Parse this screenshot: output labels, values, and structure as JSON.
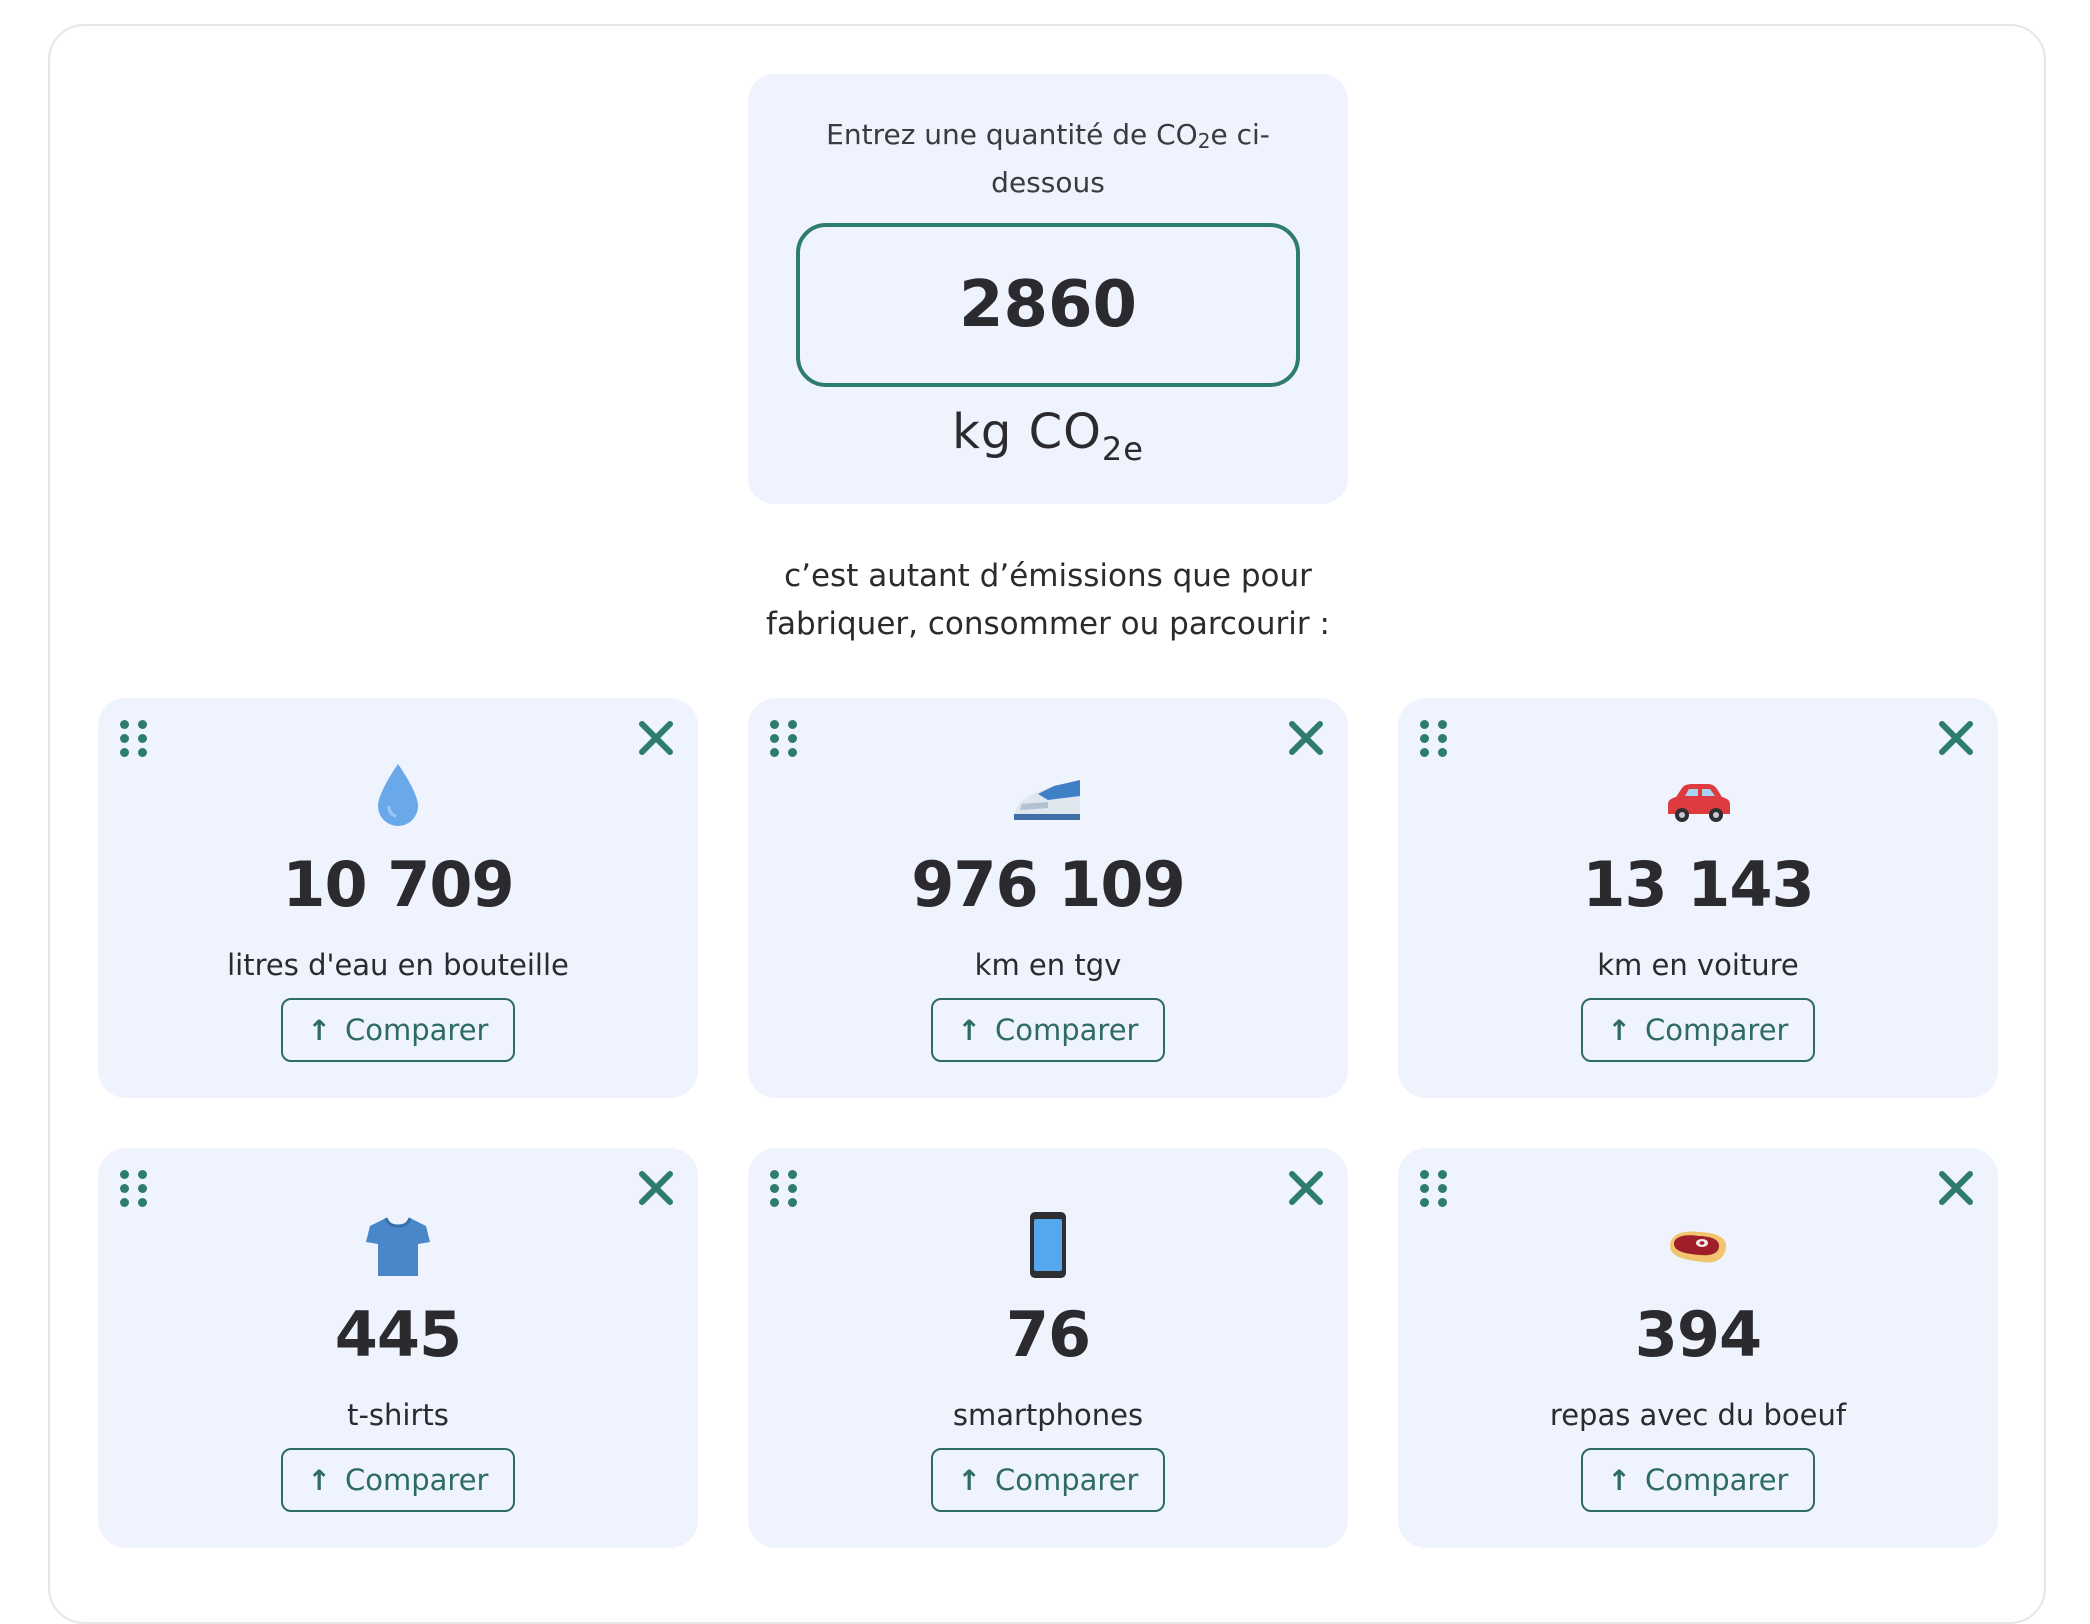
{
  "converter": {
    "prompt_main": "Entrez une quantité de CO",
    "prompt_sub": "2",
    "prompt_end": "e ci-dessous",
    "quantity": "2860",
    "unit_main": "kg CO",
    "unit_sub": "2e"
  },
  "tagline": {
    "line1": "c’est autant d’émissions que pour",
    "line2": "fabriquer, consommer ou parcourir :"
  },
  "compare_label": "Comparer",
  "items": [
    {
      "icon": "water-drop-icon",
      "value": "10 709",
      "label": "litres d'eau en bouteille"
    },
    {
      "icon": "high-speed-train-icon",
      "value": "976 109",
      "label": "km en tgv"
    },
    {
      "icon": "car-icon",
      "value": "13 143",
      "label": "km en voiture"
    },
    {
      "icon": "t-shirt-icon",
      "value": "445",
      "label": "t-shirts"
    },
    {
      "icon": "smartphone-icon",
      "value": "76",
      "label": "smartphones"
    },
    {
      "icon": "steak-icon",
      "value": "394",
      "label": "repas avec du boeuf"
    }
  ],
  "colors": {
    "accent": "#2e7b72",
    "card_bg": "#eff3fd",
    "text": "#2b2a2f"
  }
}
